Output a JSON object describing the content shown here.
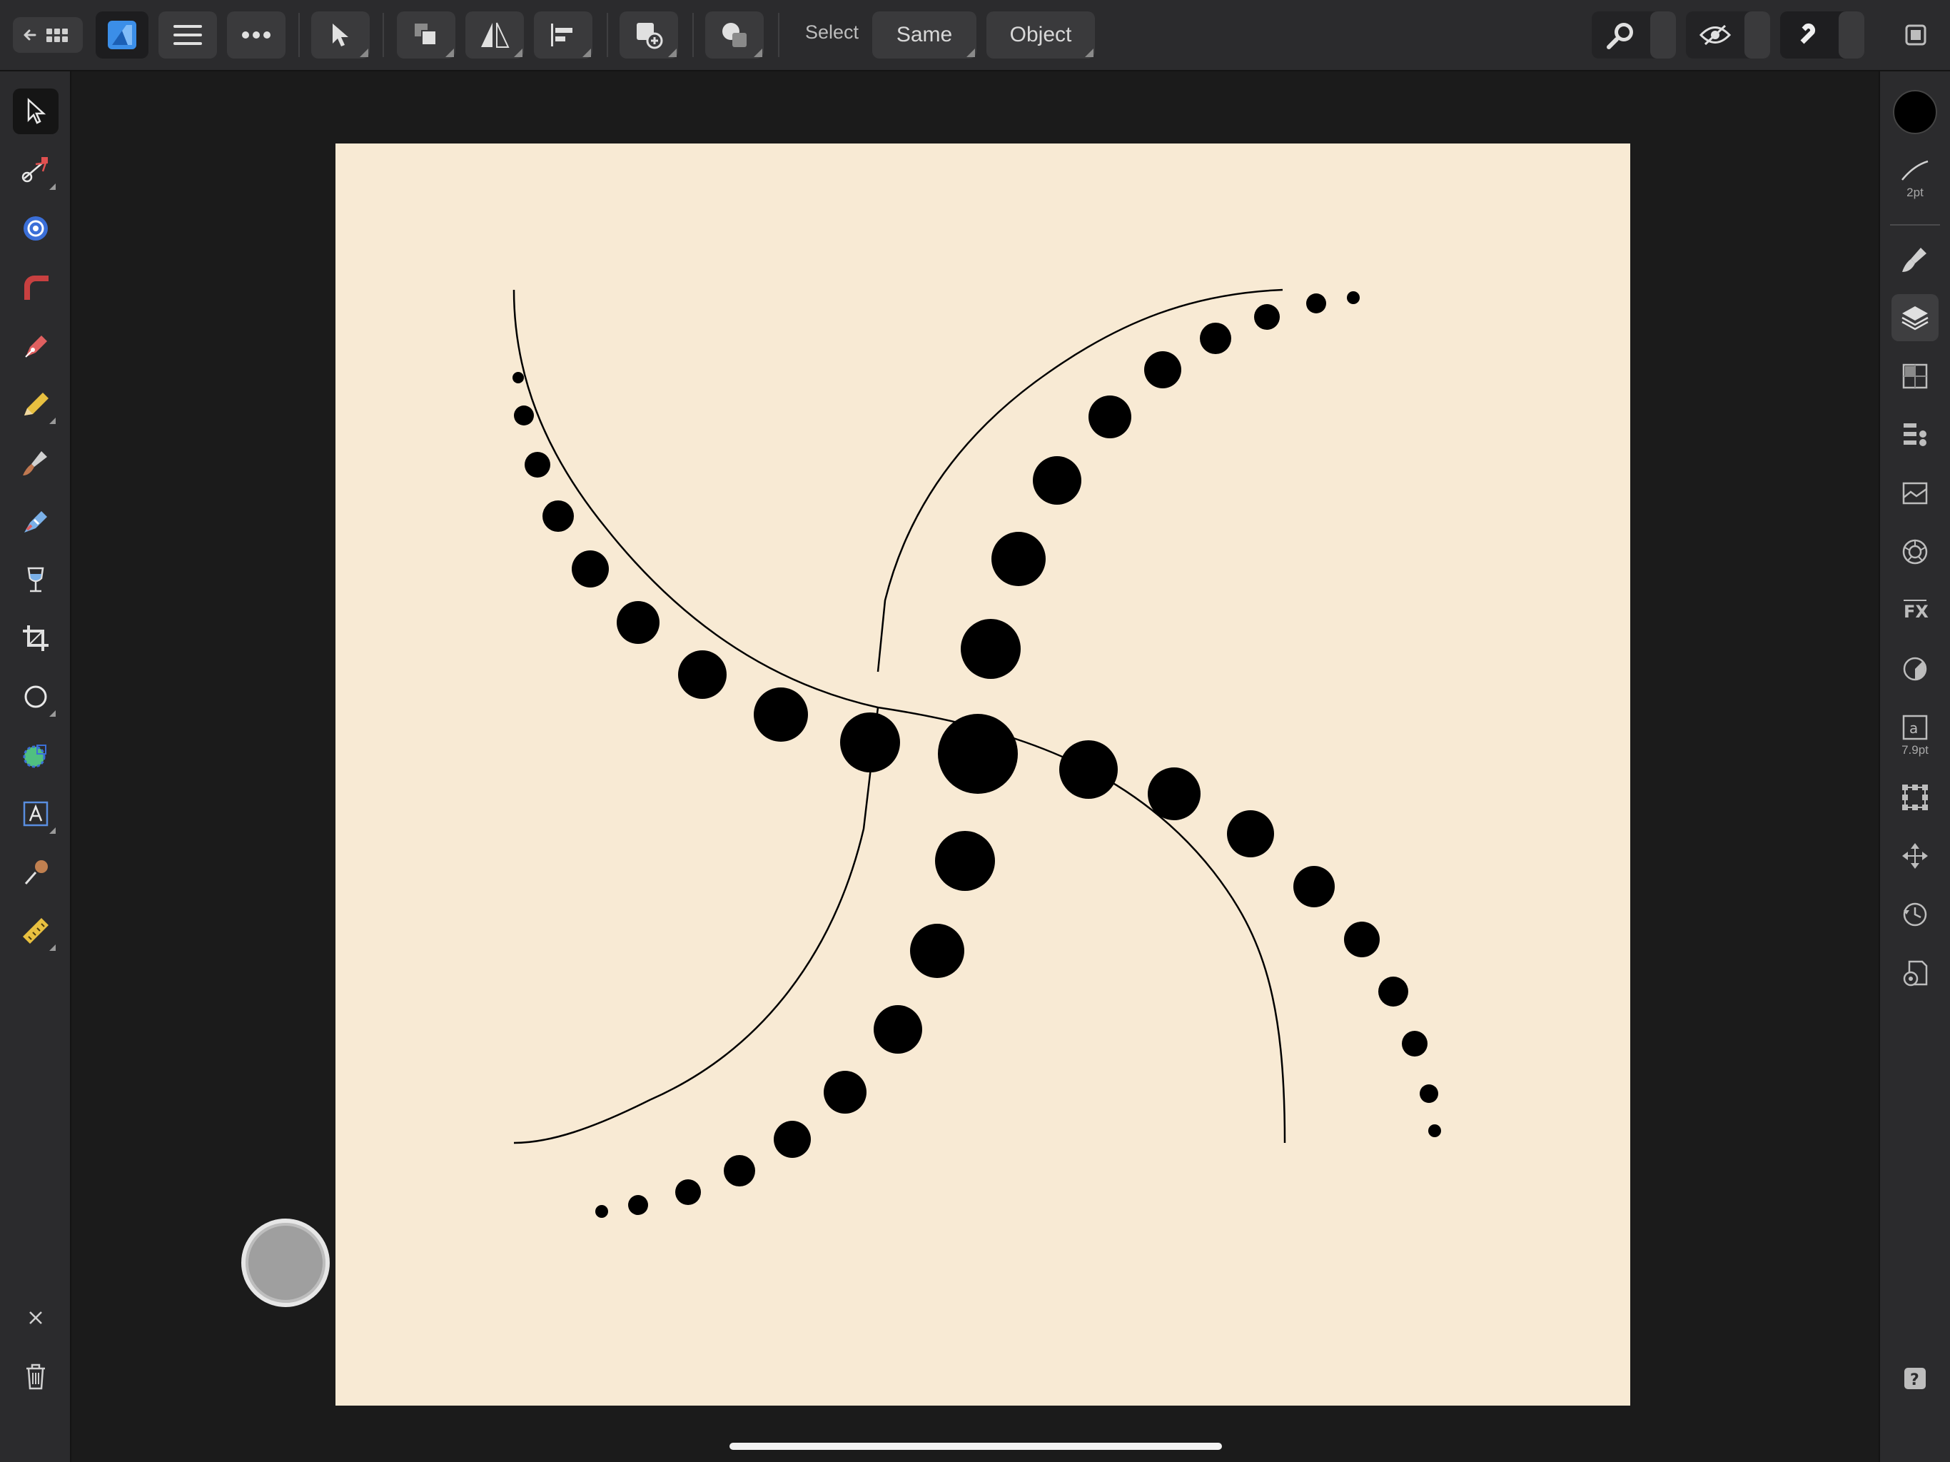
{
  "toolbar": {
    "select_label": "Select",
    "same_button": "Same",
    "object_button": "Object"
  },
  "right_panel": {
    "stroke_width": "2pt",
    "text_size": "7.9pt"
  },
  "colors": {
    "chrome": "#2b2b2d",
    "button": "#3a3a3c",
    "document": "#f8ead4",
    "accent": "#3b8ee8",
    "ink": "#000000"
  },
  "icons": {
    "top": [
      "back-arrow-icon",
      "grid-icon",
      "affinity-designer-logo-icon",
      "menu-icon",
      "more-icon",
      "move-tool-icon",
      "arrange-icon",
      "flip-icon",
      "align-icon",
      "add-object-icon",
      "boolean-icon",
      "zoom-icon",
      "view-mode-icon",
      "snapping-magnet-icon",
      "window-icon"
    ],
    "left": [
      "move-tool-icon",
      "node-tool-icon",
      "point-transform-icon",
      "corner-tool-icon",
      "pen-tool-icon",
      "pencil-tool-icon",
      "vector-brush-icon",
      "fill-tool-icon",
      "transparency-tool-icon",
      "crop-tool-icon",
      "ellipse-tool-icon",
      "shape-builder-icon",
      "artistic-text-icon",
      "color-picker-icon",
      "measure-tool-icon",
      "close-icon",
      "trash-icon"
    ],
    "right": [
      "fill-color-icon",
      "stroke-icon",
      "brushes-icon",
      "layers-icon",
      "transparency-icon",
      "appearance-icon",
      "styles-icon",
      "color-icon",
      "fx-icon",
      "adjustments-icon",
      "text-style-icon",
      "transform-icon",
      "navigator-icon",
      "history-icon",
      "document-settings-icon",
      "help-icon"
    ]
  }
}
